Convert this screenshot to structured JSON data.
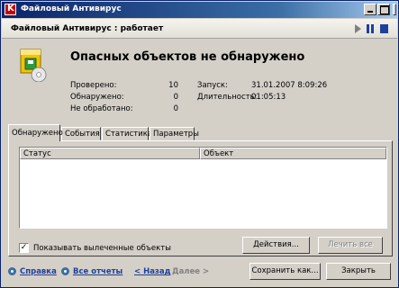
{
  "window": {
    "title": "Файловый Антивирус",
    "app_icon_letter": "K"
  },
  "header": {
    "title": "Файловый Антивирус : работает"
  },
  "status": {
    "message": "Опасных объектов не обнаружено",
    "stats": [
      {
        "label": "Проверено:",
        "value": "10"
      },
      {
        "label": "Обнаружено:",
        "value": "0"
      },
      {
        "label": "Не обработано:",
        "value": "0"
      }
    ],
    "info": [
      {
        "label": "Запуск:",
        "value": "31.01.2007 8:09:26"
      },
      {
        "label": "Длительность:",
        "value": "01:05:13"
      }
    ]
  },
  "tabs": [
    {
      "label": "Обнаружено",
      "active": true
    },
    {
      "label": "События",
      "active": false
    },
    {
      "label": "Статистика",
      "active": false
    },
    {
      "label": "Параметры",
      "active": false
    }
  ],
  "table": {
    "columns": [
      "Статус",
      "Объект"
    ]
  },
  "options": {
    "show_cured_label": "Показывать вылеченные объекты",
    "show_cured_checked": true
  },
  "panel_buttons": {
    "actions": "Действия...",
    "cure_all": "Лечить все"
  },
  "footer": {
    "help": "Справка",
    "all_reports": "Все отчеты",
    "back": "< Назад",
    "next": "Далее >",
    "save_as": "Сохранить как...",
    "close": "Закрыть"
  },
  "colors": {
    "title_gradient_start": "#0a246a",
    "link": "#1f3f9a",
    "shield_yellow": "#f2c400",
    "shield_green": "#2e9a3e"
  }
}
